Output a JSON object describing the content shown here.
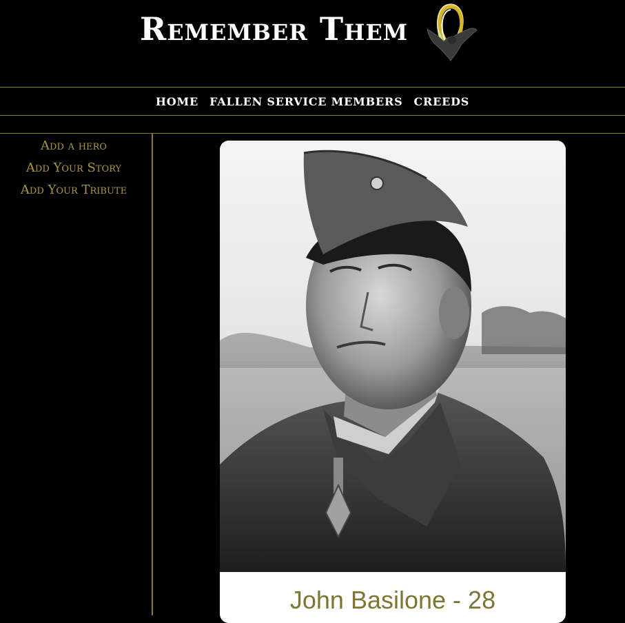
{
  "header": {
    "site_title": "Remember Them",
    "logo_icon": "ribbon-eagle-icon"
  },
  "nav": {
    "items": [
      {
        "label": "HOME"
      },
      {
        "label": "FALLEN SERVICE MEMBERS"
      },
      {
        "label": "CREEDS"
      }
    ]
  },
  "sidebar": {
    "items": [
      {
        "label": "Add a hero"
      },
      {
        "label": "Add Your Story"
      },
      {
        "label": "Add Your Tribute"
      }
    ]
  },
  "hero": {
    "name": "John Basilone - 28"
  },
  "colors": {
    "background": "#000000",
    "accent_gold": "#a9973f",
    "divider_gold": "#8a7d3a",
    "name_olive": "#7d7530"
  }
}
